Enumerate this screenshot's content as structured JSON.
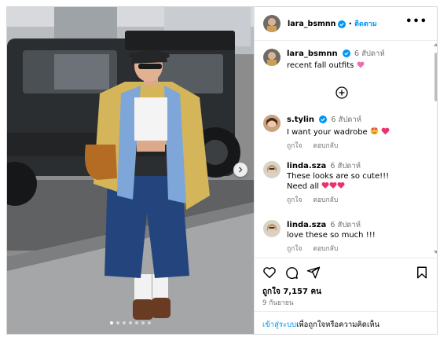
{
  "header": {
    "username": "lara_bsmnn",
    "follow_label": "ติดตาม",
    "separator": "•",
    "more_label": "•••"
  },
  "caption": {
    "username": "lara_bsmnn",
    "time": "6 สัปดาห์",
    "text": "recent fall outfits"
  },
  "comments": [
    {
      "username": "s.tylin",
      "verified": true,
      "time": "6 สัปดาห์",
      "lines": [
        "I want your wadrobe"
      ],
      "like_label": "ถูกใจ",
      "reply_label": "ตอบกลับ"
    },
    {
      "username": "linda.sza",
      "verified": false,
      "time": "6 สัปดาห์",
      "lines": [
        "These looks are so cute!!!",
        "Need all"
      ],
      "like_label": "ถูกใจ",
      "reply_label": "ตอบกลับ"
    },
    {
      "username": "linda.sza",
      "verified": false,
      "time": "6 สัปดาห์",
      "lines": [
        "love these so much !!!"
      ],
      "like_label": "ถูกใจ",
      "reply_label": "ตอบกลับ"
    }
  ],
  "stats": {
    "likes": "ถูกใจ 7,157 คน",
    "date": "9 กันยายน"
  },
  "login_prompt": {
    "link": "เข้าสู่ระบบ",
    "rest": "เพื่อถูกใจหรือความคิดเห็น"
  },
  "carousel": {
    "count": 7,
    "active": 0
  },
  "colors": {
    "link": "#0095f6",
    "verified": "#0095f6",
    "heart": "#e8336b",
    "muted": "#737373"
  }
}
